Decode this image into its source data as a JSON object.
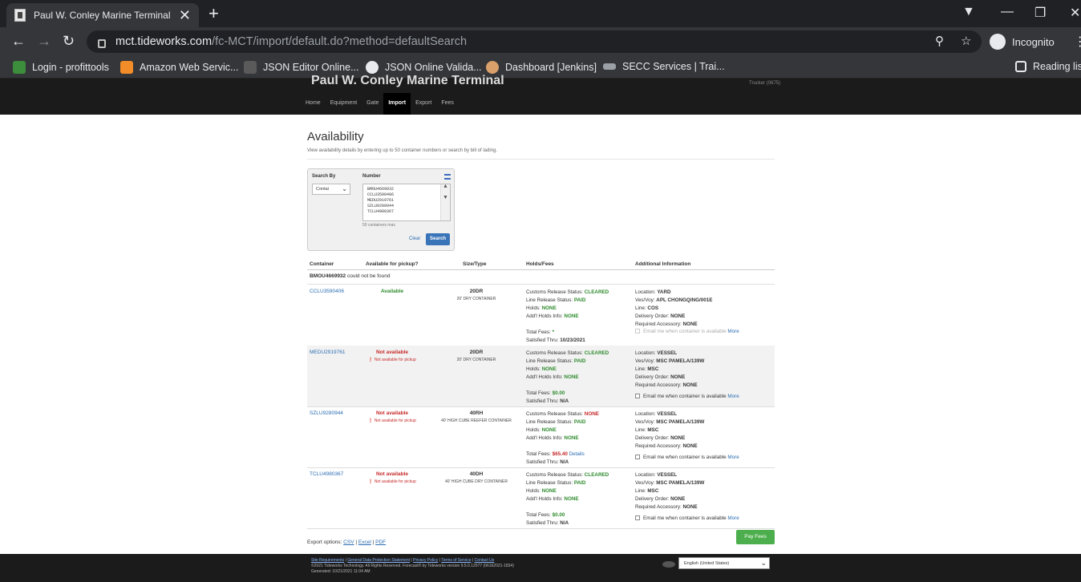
{
  "browser": {
    "tab_title": "Paul W. Conley Marine Terminal - ",
    "tab_close": "✕",
    "new_tab": "+",
    "url_host": "mct.tideworks.com",
    "url_path": "/fc-MCT/import/default.do?method=defaultSearch",
    "profile": "Incognito",
    "bookmarks": [
      {
        "label": "Login - profittools",
        "color": "#3c8d3c"
      },
      {
        "label": "Amazon Web Servic...",
        "color": "#f28c28"
      },
      {
        "label": "JSON Editor Online...",
        "color": "#5a5a5a"
      },
      {
        "label": "JSON Online Valida...",
        "color": "#e8eaed"
      },
      {
        "label": "Dashboard [Jenkins]",
        "color": "#d9a06b"
      },
      {
        "label": "SECC Services | Trai...",
        "color": "#9aa0a6"
      }
    ],
    "reading_list": "Reading list"
  },
  "site": {
    "title": "Paul W. Conley Marine Terminal",
    "trucker": "Trucker (0675)",
    "nav": [
      "Home",
      "Equipment",
      "Gate",
      "Import",
      "Export",
      "Fees"
    ],
    "active_nav": "Import"
  },
  "page": {
    "heading": "Availability",
    "subtitle": "View availability details by entering up to 50 container numbers or search by bill of lading."
  },
  "search": {
    "search_by_label": "Search By",
    "search_by_value": "Contai",
    "number_label": "Number",
    "numbers": [
      "BMOU4669932",
      "CCLU3590406",
      "MEDU2919761",
      "SZLU9280944",
      "TCLU4980367"
    ],
    "max_note": "50 containers max",
    "clear": "Clear",
    "search": "Search"
  },
  "table": {
    "headers": [
      "Container",
      "Available for pickup?",
      "Size/Type",
      "Holds/Fees",
      "Additional Information"
    ],
    "not_found_id": "BMOU4669932",
    "not_found_text": "could not be found",
    "rows": [
      {
        "id": "CCLU3590406",
        "avail": "Available",
        "avail_sub": "",
        "size": "20DR",
        "size_desc": "20' DRY CONTAINER",
        "customs": "CLEARED",
        "line": "PAID",
        "holds": "NONE",
        "addl": "NONE",
        "fees": "*",
        "fees_details": "",
        "sat_label": "Satisfied Thru:",
        "sat": "10/23/2021",
        "location": "YARD",
        "vesvoy": "APL CHONGQING/001E",
        "line_op": "COS",
        "delivery": "NONE",
        "accessory": "NONE",
        "email": "Email me when container is available",
        "more": "More"
      },
      {
        "id": "MEDU2919761",
        "avail": "Not available",
        "avail_sub": "Not available for pickup",
        "size": "20DR",
        "size_desc": "20' DRY CONTAINER",
        "customs": "CLEARED",
        "line": "PAID",
        "holds": "NONE",
        "addl": "NONE",
        "fees": "$0.00",
        "fees_details": "",
        "sat_label": "Satisfied Thru:",
        "sat": "N/A",
        "location": "VESSEL",
        "vesvoy": "MSC PAMELA/139W",
        "line_op": "MSC",
        "delivery": "NONE",
        "accessory": "NONE",
        "email": "Email me when container is available",
        "more": "More"
      },
      {
        "id": "SZLU9280944",
        "avail": "Not available",
        "avail_sub": "Not available for pickup",
        "size": "40RH",
        "size_desc": "40' HIGH CUBE REEFER CONTAINER",
        "customs": "NONE",
        "line": "PAID",
        "holds": "NONE",
        "addl": "NONE",
        "fees": "$65.40",
        "fees_details": "Details",
        "sat_label": "Satisfied Thru:",
        "sat": "N/A",
        "location": "VESSEL",
        "vesvoy": "MSC PAMELA/139W",
        "line_op": "MSC",
        "delivery": "NONE",
        "accessory": "NONE",
        "email": "Email me when container is available",
        "more": "More"
      },
      {
        "id": "TCLU4980367",
        "avail": "Not available",
        "avail_sub": "Not available for pickup",
        "size": "40DH",
        "size_desc": "40' HIGH CUBE DRY CONTAINER",
        "customs": "CLEARED",
        "line": "PAID",
        "holds": "NONE",
        "addl": "NONE",
        "fees": "$0.00",
        "fees_details": "",
        "sat_label": "Satisfied Thru:",
        "sat": "N/A",
        "location": "VESSEL",
        "vesvoy": "MSC PAMELA/139W",
        "line_op": "MSC",
        "delivery": "NONE",
        "accessory": "NONE",
        "email": "Email me when container is available",
        "more": "More"
      }
    ]
  },
  "labels": {
    "customs": "Customs Release Status:",
    "line_release": "Line Release Status:",
    "holds": "Holds:",
    "addl": "Add'l Holds Info:",
    "total_fees": "Total Fees:",
    "location": "Location:",
    "vesvoy": "Ves/Voy:",
    "line": "Line:",
    "delivery": "Delivery Order:",
    "accessory": "Required Accessory:"
  },
  "export": {
    "label": "Export options:",
    "csv": "CSV",
    "excel": "Excel",
    "pdf": "PDF",
    "sep": "|"
  },
  "pay_fees": "Pay Fees",
  "footer": {
    "links": [
      "Site Requirements",
      "General Data Protection Statement",
      "Privacy Policy",
      "Terms of Service",
      "Contact Us"
    ],
    "copyright": "©2021 Tideworks Technology. All Rights Reserved. Forecast® by Tideworks version 9.5.0.12077 (06162021-1834)",
    "generated": "Generated: 10/21/2021 11:04 AM",
    "language": "English (United States)"
  }
}
